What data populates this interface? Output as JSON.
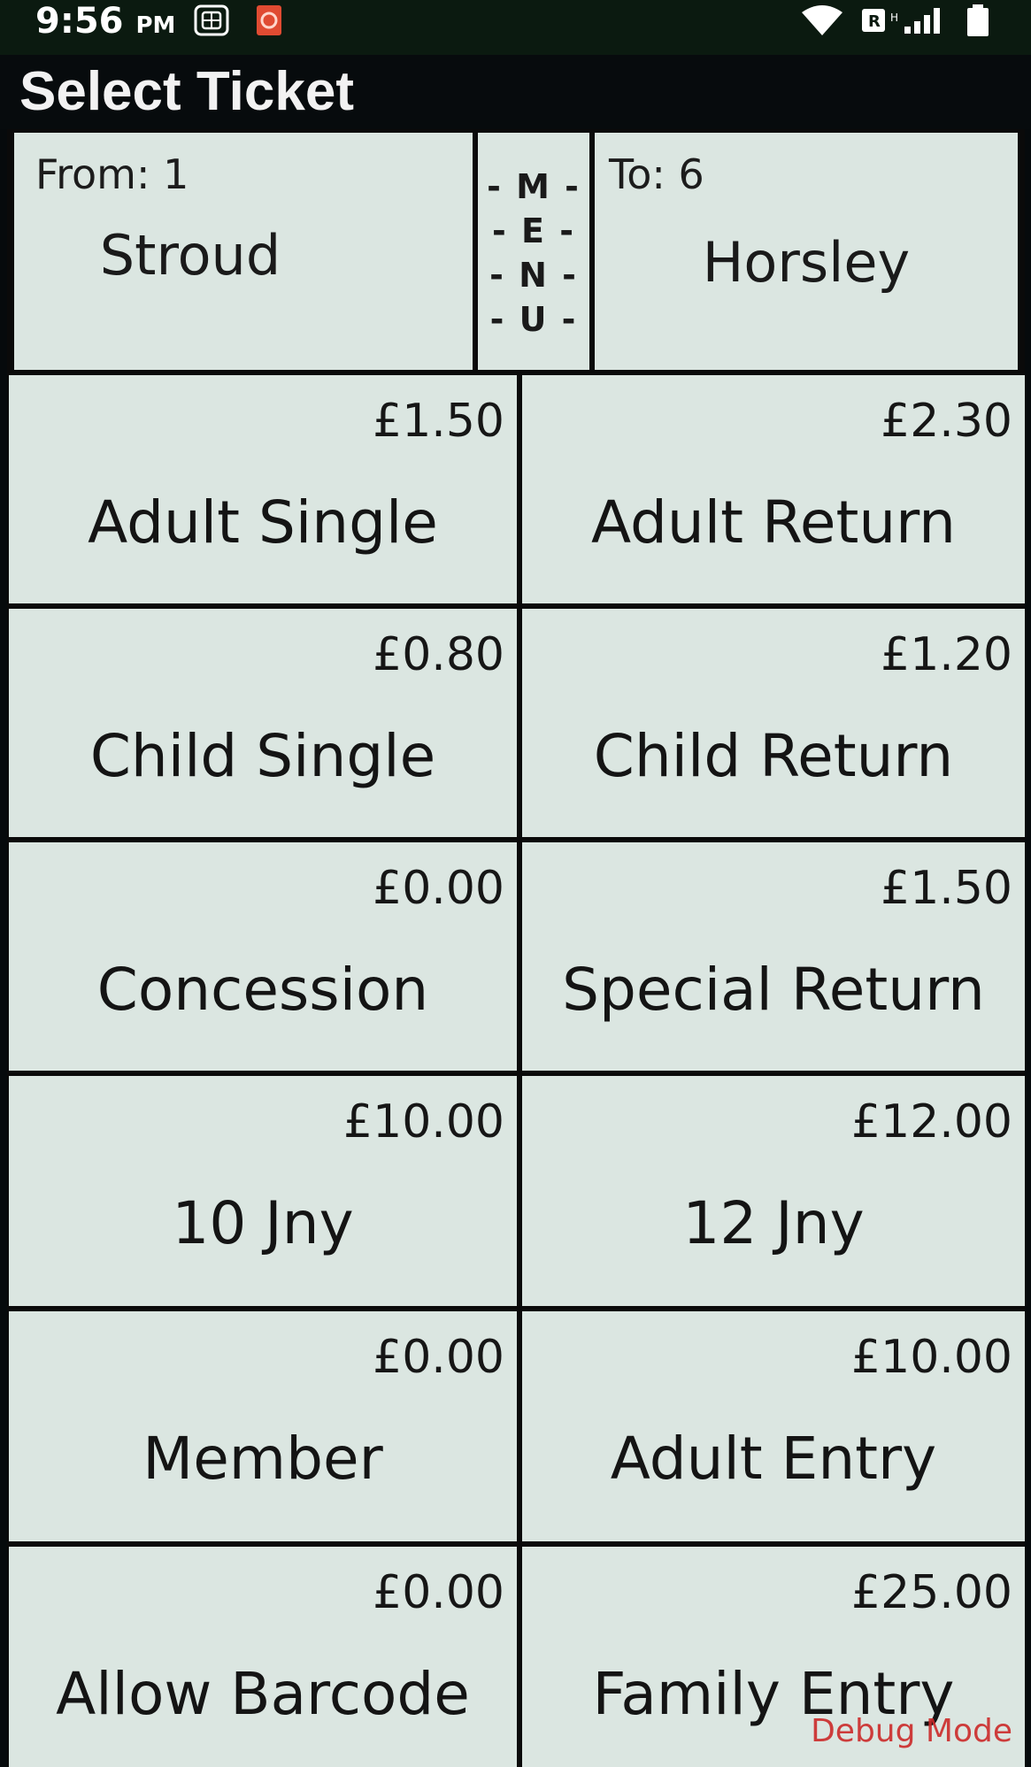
{
  "status_bar": {
    "time": "9:56",
    "ampm": "PM",
    "icons": [
      "sim-card-icon",
      "app-notification-icon",
      "wifi-icon",
      "signal-icon",
      "battery-icon"
    ]
  },
  "header": {
    "title": "Select Ticket"
  },
  "stations": {
    "from_label": "From: 1",
    "from_name": "Stroud",
    "to_label": "To: 6",
    "to_name": "Horsley",
    "menu_letters": [
      "- M -",
      "- E -",
      "- N -",
      "- U -"
    ]
  },
  "tickets": [
    {
      "name": "Adult Single",
      "price": "£1.50"
    },
    {
      "name": "Adult Return",
      "price": "£2.30"
    },
    {
      "name": "Child Single",
      "price": "£0.80"
    },
    {
      "name": "Child Return",
      "price": "£1.20"
    },
    {
      "name": "Concession",
      "price": "£0.00"
    },
    {
      "name": "Special Return",
      "price": "£1.50"
    },
    {
      "name": "10 Jny",
      "price": "£10.00"
    },
    {
      "name": "12 Jny",
      "price": "£12.00"
    },
    {
      "name": "Member",
      "price": "£0.00"
    },
    {
      "name": "Adult Entry",
      "price": "£10.00"
    },
    {
      "name": "Allow Barcode",
      "price": "£0.00"
    },
    {
      "name": "Family Entry",
      "price": "£25.00"
    }
  ],
  "debug_label": "Debug Mode",
  "colors": {
    "cell_background": "#dbe6e1",
    "grid_lines": "#0a0a0a",
    "debug_text": "#cc2a2a"
  }
}
